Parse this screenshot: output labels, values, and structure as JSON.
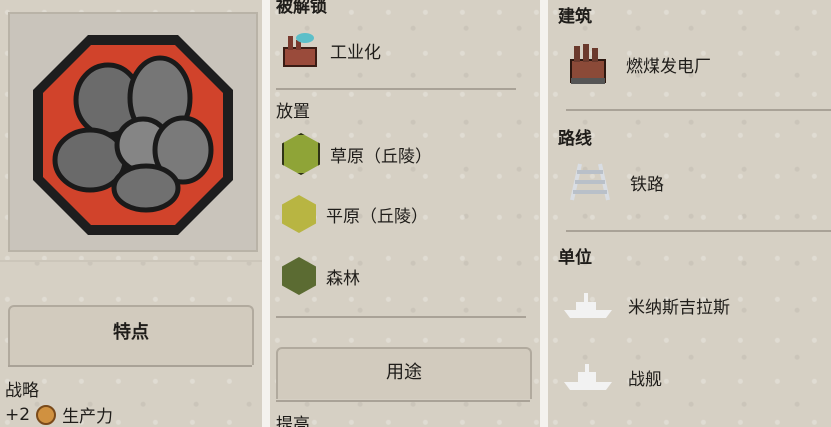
{
  "left_panel": {
    "resource_icon": "coal-resource-icon",
    "features_title": "特点",
    "strategic_label": "战略",
    "production_bonus_prefix": "+2",
    "production_icon": "production-icon",
    "production_label": "生产力"
  },
  "middle_panel": {
    "unlocked_by_header": "被解锁",
    "unlocked_item": {
      "label": "工业化",
      "icon": "factory-icon"
    },
    "placement_header": "放置",
    "placement_items": [
      {
        "label": "草原（丘陵）",
        "icon": "grassland-hex-icon",
        "color": "#8fa437"
      },
      {
        "label": "平原（丘陵）",
        "icon": "plains-hex-icon",
        "color": "#b8b542"
      },
      {
        "label": "森林",
        "icon": "forest-hex-icon",
        "color": "#5b6b32"
      }
    ],
    "uses_button": "用途",
    "bottom_partial_header": "提高"
  },
  "right_panel": {
    "buildings_header": "建筑",
    "building_item": {
      "label": "燃煤发电厂",
      "icon": "power-plant-icon"
    },
    "routes_header": "路线",
    "route_item": {
      "label": "铁路",
      "icon": "railroad-icon"
    },
    "units_header": "单位",
    "units": [
      {
        "label": "米纳斯吉拉斯",
        "icon": "dreadnought-ship-icon"
      },
      {
        "label": "战舰",
        "icon": "battleship-icon"
      }
    ]
  }
}
